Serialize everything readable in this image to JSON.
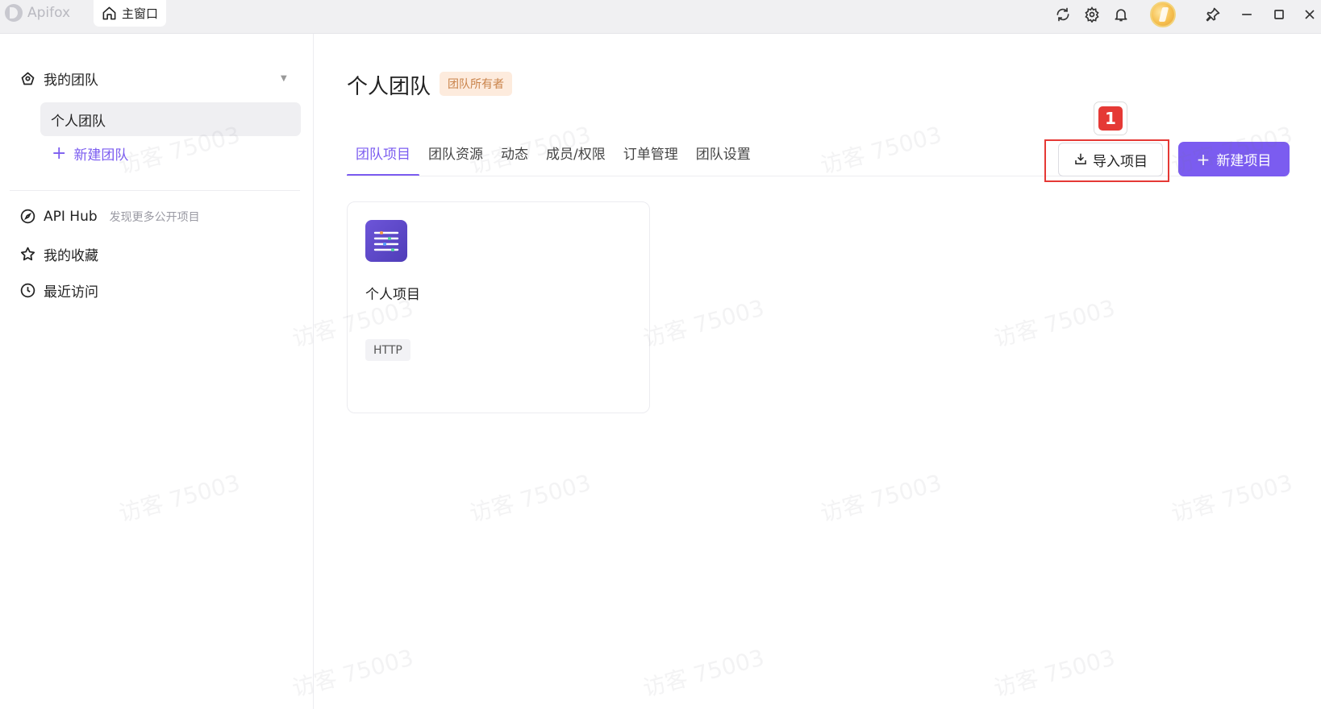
{
  "titlebar": {
    "app_name": "Apifox",
    "home_tab_label": "主窗口",
    "icons": [
      "refresh-icon",
      "settings-icon",
      "bell-icon",
      "avatar",
      "pin-icon",
      "minimize-icon",
      "maximize-icon",
      "close-icon"
    ]
  },
  "sidebar": {
    "team_header": "我的团队",
    "team_item": "个人团队",
    "new_team": "新建团队",
    "nav": [
      {
        "label": "API Hub",
        "hint": "发现更多公开项目",
        "icon": "compass-icon"
      },
      {
        "label": "我的收藏",
        "icon": "star-icon"
      },
      {
        "label": "最近访问",
        "icon": "clock-icon"
      }
    ]
  },
  "main": {
    "title": "个人团队",
    "owner_badge": "团队所有者",
    "tabs": [
      "团队项目",
      "团队资源",
      "动态",
      "成员/权限",
      "订单管理",
      "团队设置"
    ],
    "active_tab": 0,
    "import_button": "导入项目",
    "new_project_button": "新建项目",
    "callout_number": "1",
    "projects": [
      {
        "name": "个人项目",
        "tag": "HTTP"
      }
    ]
  },
  "watermark_text": "访客 75003",
  "colors": {
    "accent": "#7b5cf0",
    "callout_red": "#e53935",
    "badge_bg": "#fdebdd",
    "badge_text": "#c9834a"
  }
}
